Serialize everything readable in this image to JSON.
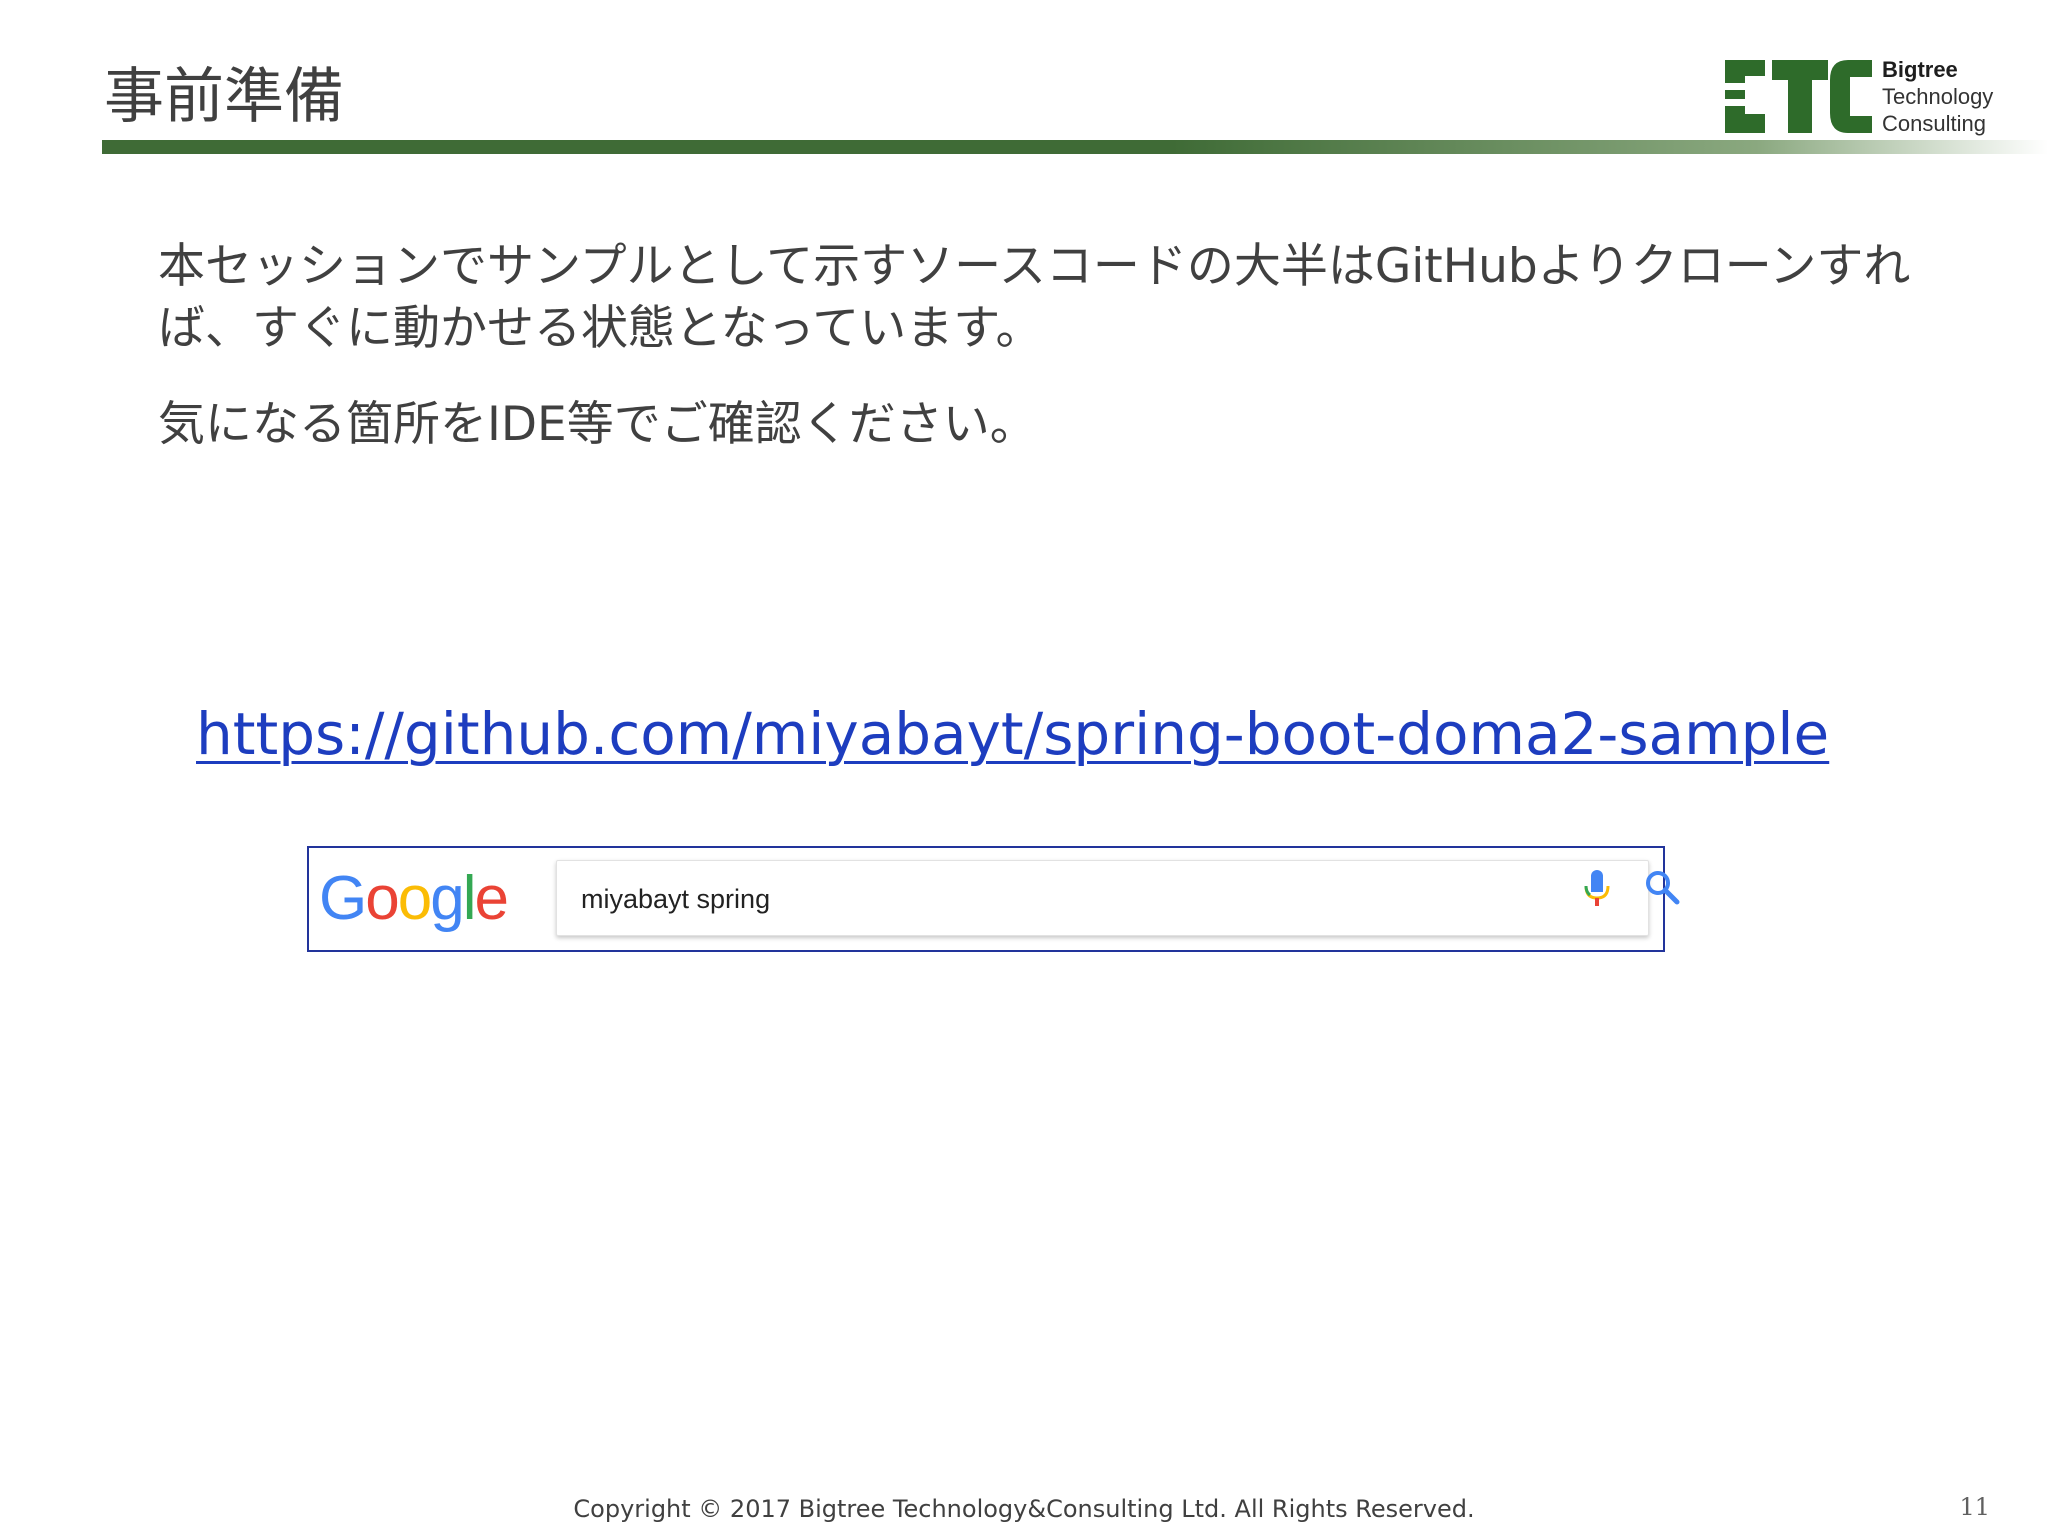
{
  "slide": {
    "title": "事前準備",
    "logo": {
      "line1": "Bigtree",
      "line2": "Technology",
      "line3": "Consulting"
    },
    "paragraphs": [
      "本セッションでサンプルとして示すソースコードの大半はGitHubよりクローンすれば、すぐに動かせる状態となっています。",
      "気になる箇所をIDE等でご確認ください。"
    ],
    "repo_link": "https://github.com/miyabayt/spring-boot-doma2-sample",
    "search": {
      "logo_letters": [
        "G",
        "o",
        "o",
        "g",
        "l",
        "e"
      ],
      "query": "miyabayt spring",
      "mic_icon": "microphone-icon",
      "search_icon": "magnifier-icon"
    },
    "footer": "Copyright © 2017 Bigtree Technology&Consulting Ltd. All Rights Reserved.",
    "page_number": "11"
  },
  "colors": {
    "title_rule": "#3f6b36",
    "link": "#1d3dbf",
    "frame": "#22349b",
    "google_blue": "#4285f4",
    "google_red": "#ea4335",
    "google_yellow": "#fbbc05",
    "google_green": "#34a853"
  }
}
